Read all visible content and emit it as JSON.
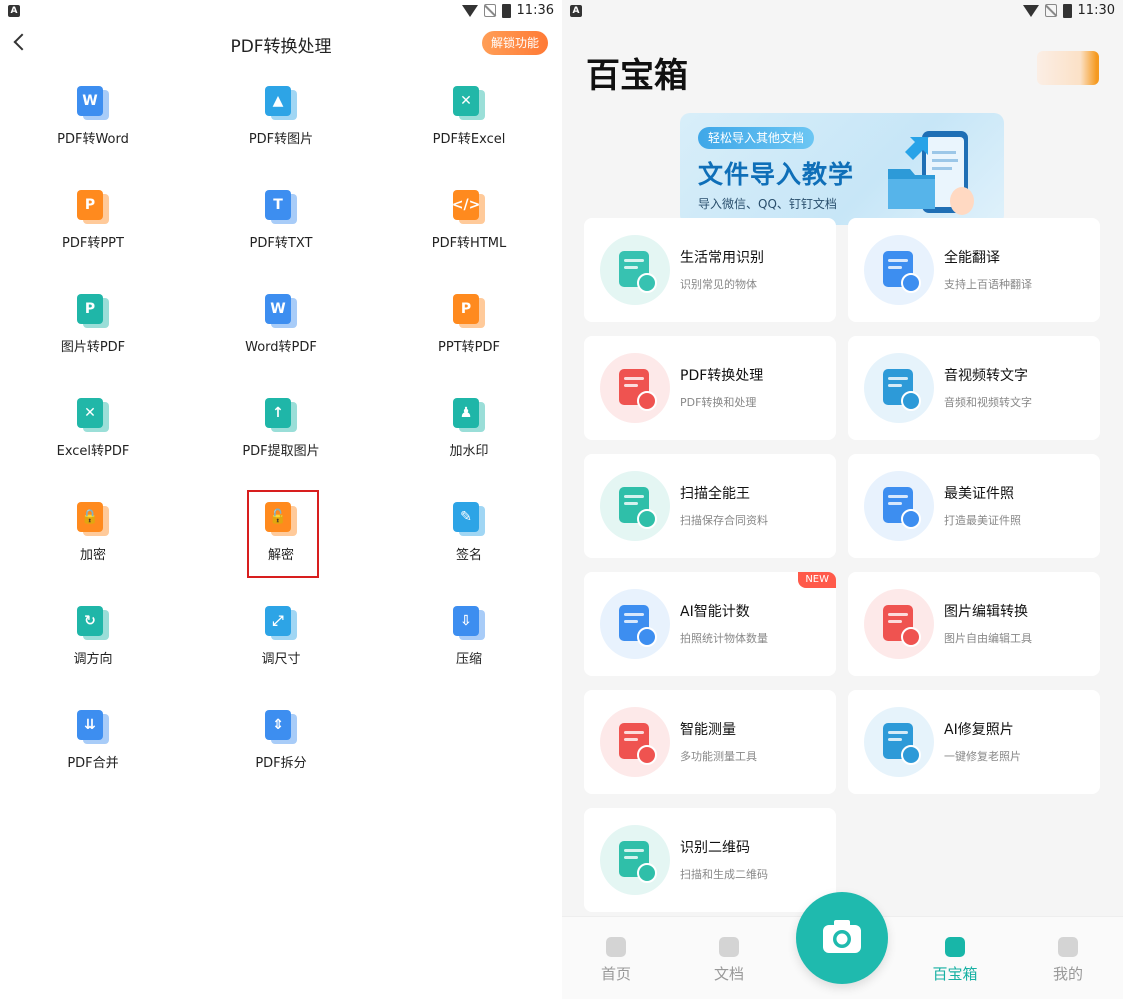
{
  "left": {
    "status": {
      "time": "11:36"
    },
    "header": {
      "title": "PDF转换处理",
      "unlock_label": "解锁功能"
    },
    "tools": [
      {
        "label": "PDF转Word",
        "icon": "pdf-to-word-icon",
        "color": "#3d8ef0",
        "mark": "W"
      },
      {
        "label": "PDF转图片",
        "icon": "pdf-to-image-icon",
        "color": "#2da4e6",
        "mark": "▲"
      },
      {
        "label": "PDF转Excel",
        "icon": "pdf-to-excel-icon",
        "color": "#21b7a8",
        "mark": "✕"
      },
      {
        "label": "PDF转PPT",
        "icon": "pdf-to-ppt-icon",
        "color": "#ff8a1e",
        "mark": "P"
      },
      {
        "label": "PDF转TXT",
        "icon": "pdf-to-txt-icon",
        "color": "#3d8ef0",
        "mark": "T"
      },
      {
        "label": "PDF转HTML",
        "icon": "pdf-to-html-icon",
        "color": "#ff8a1e",
        "mark": "</>"
      },
      {
        "label": "图片转PDF",
        "icon": "image-to-pdf-icon",
        "color": "#1fb6a8",
        "mark": "P"
      },
      {
        "label": "Word转PDF",
        "icon": "word-to-pdf-icon",
        "color": "#3d8ef0",
        "mark": "W"
      },
      {
        "label": "PPT转PDF",
        "icon": "ppt-to-pdf-icon",
        "color": "#ff8a1e",
        "mark": "P"
      },
      {
        "label": "Excel转PDF",
        "icon": "excel-to-pdf-icon",
        "color": "#21b7a8",
        "mark": "✕"
      },
      {
        "label": "PDF提取图片",
        "icon": "extract-image-icon",
        "color": "#1fb6a8",
        "mark": "↑"
      },
      {
        "label": "加水印",
        "icon": "watermark-icon",
        "color": "#1fb6a8",
        "mark": "♟"
      },
      {
        "label": "加密",
        "icon": "lock-icon",
        "color": "#ff8a1e",
        "mark": "🔒"
      },
      {
        "label": "解密",
        "icon": "unlock-icon",
        "color": "#ff8a1e",
        "mark": "🔓"
      },
      {
        "label": "签名",
        "icon": "signature-icon",
        "color": "#2da4e6",
        "mark": "✎"
      },
      {
        "label": "调方向",
        "icon": "rotate-icon",
        "color": "#1fb6a8",
        "mark": "↻"
      },
      {
        "label": "调尺寸",
        "icon": "resize-icon",
        "color": "#2da4e6",
        "mark": "⤢"
      },
      {
        "label": "压缩",
        "icon": "compress-icon",
        "color": "#3d8ef0",
        "mark": "⇩"
      },
      {
        "label": "PDF合并",
        "icon": "merge-icon",
        "color": "#3d8ef0",
        "mark": "⇊"
      },
      {
        "label": "PDF拆分",
        "icon": "split-icon",
        "color": "#3d8ef0",
        "mark": "⇕"
      }
    ]
  },
  "right": {
    "status": {
      "time": "11:30"
    },
    "title": "百宝箱",
    "banner": {
      "pill": "轻松导入其他文档",
      "title": "文件导入教学",
      "subtitle": "导入微信、QQ、钉钉文档"
    },
    "cards": [
      {
        "title": "生活常用识别",
        "subtitle": "识别常见的物体",
        "icon": "house-icon",
        "bg": "#e4f6f3",
        "fg": "#37c2b1"
      },
      {
        "title": "全能翻译",
        "subtitle": "支持上百语种翻译",
        "icon": "translate-icon",
        "bg": "#e8f2fd",
        "fg": "#3d8ef0"
      },
      {
        "title": "PDF转换处理",
        "subtitle": "PDF转换和处理",
        "icon": "pdf-icon",
        "bg": "#fde9e9",
        "fg": "#ef5350"
      },
      {
        "title": "音视频转文字",
        "subtitle": "音频和视频转文字",
        "icon": "video-text-icon",
        "bg": "#e6f3fb",
        "fg": "#2d9ad8"
      },
      {
        "title": "扫描全能王",
        "subtitle": "扫描保存合同资料",
        "icon": "scan-doc-icon",
        "bg": "#e4f6f3",
        "fg": "#2fbfa9"
      },
      {
        "title": "最美证件照",
        "subtitle": "打造最美证件照",
        "icon": "id-photo-icon",
        "bg": "#e8f2fd",
        "fg": "#3d8ef0"
      },
      {
        "title": "AI智能计数",
        "subtitle": "拍照统计物体数量",
        "icon": "ai-count-icon",
        "bg": "#e8f2fd",
        "fg": "#3d8ef0",
        "badge": "NEW"
      },
      {
        "title": "图片编辑转换",
        "subtitle": "图片自由编辑工具",
        "icon": "image-edit-icon",
        "bg": "#fde9e9",
        "fg": "#ef5350"
      },
      {
        "title": "智能测量",
        "subtitle": "多功能测量工具",
        "icon": "ruler-icon",
        "bg": "#fde9e9",
        "fg": "#ef5350"
      },
      {
        "title": "AI修复照片",
        "subtitle": "一键修复老照片",
        "icon": "photo-repair-icon",
        "bg": "#e6f3fb",
        "fg": "#2d9ad8"
      },
      {
        "title": "识别二维码",
        "subtitle": "扫描和生成二维码",
        "icon": "qrcode-icon",
        "bg": "#e4f6f3",
        "fg": "#2fbfa9"
      }
    ],
    "tabs": [
      {
        "label": "首页",
        "icon": "home-icon"
      },
      {
        "label": "文档",
        "icon": "document-icon"
      },
      {
        "label": "百宝箱",
        "icon": "toolbox-icon",
        "active": true
      },
      {
        "label": "我的",
        "icon": "profile-icon"
      }
    ]
  }
}
